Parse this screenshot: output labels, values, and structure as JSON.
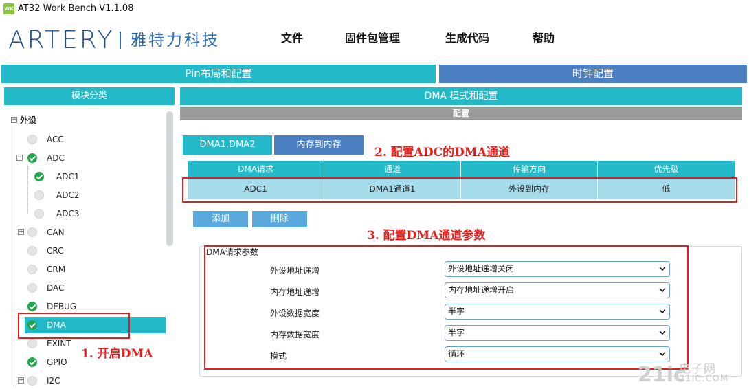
{
  "app": {
    "icon_text": "WK",
    "title": "AT32 Work Bench V1.1.08"
  },
  "logo": {
    "brand": "ARTERY",
    "cn": "雅特力科技"
  },
  "menu": [
    "文件",
    "固件包管理",
    "生成代码",
    "帮助"
  ],
  "main_tabs": {
    "pin": "Pin布局和配置",
    "clock": "时钟配置"
  },
  "left_panel": {
    "header": "模块分类",
    "root": "外设",
    "items": [
      {
        "label": "ACC",
        "status": "off",
        "expandable": false
      },
      {
        "label": "ADC",
        "status": "ok",
        "expandable": true,
        "expanded": true
      },
      {
        "label": "ADC1",
        "status": "ok",
        "child": true
      },
      {
        "label": "ADC2",
        "status": "off",
        "child": true
      },
      {
        "label": "ADC3",
        "status": "off",
        "child": true
      },
      {
        "label": "CAN",
        "status": "off",
        "expandable": true
      },
      {
        "label": "CRC",
        "status": "off"
      },
      {
        "label": "CRM",
        "status": "off"
      },
      {
        "label": "DAC",
        "status": "off"
      },
      {
        "label": "DEBUG",
        "status": "ok"
      },
      {
        "label": "DMA",
        "status": "ok",
        "selected": true
      },
      {
        "label": "EXINT",
        "status": "off"
      },
      {
        "label": "GPIO",
        "status": "ok"
      },
      {
        "label": "I2C",
        "status": "off",
        "expandable": true
      }
    ]
  },
  "right_panel": {
    "header": "DMA 模式和配置",
    "sub_header": "配置",
    "subtabs": [
      "DMA1,DMA2",
      "内存到内存"
    ],
    "table": {
      "columns": [
        "DMA请求",
        "通道",
        "传输方向",
        "优先级"
      ],
      "rows": [
        [
          "ADC1",
          "DMA1通道1",
          "外设到内存",
          "低"
        ]
      ]
    },
    "buttons": {
      "add": "添加",
      "delete": "删除"
    },
    "params": {
      "title": "DMA请求参数",
      "fields": [
        {
          "label": "外设地址递增",
          "value": "外设地址递增关闭"
        },
        {
          "label": "内存地址递增",
          "value": "内存地址递增开启"
        },
        {
          "label": "外设数据宽度",
          "value": "半字"
        },
        {
          "label": "内存数据宽度",
          "value": "半字"
        },
        {
          "label": "模式",
          "value": "循环"
        }
      ]
    }
  },
  "annotations": {
    "a1": "1. 开启DMA",
    "a2": "2. 配置ADC的DMA通道",
    "a3": "3. 配置DMA通道参数",
    "color": "#e0201c"
  },
  "watermark": {
    "big": "21ic",
    "cn": "电子网",
    "url": "21IC.COM"
  }
}
